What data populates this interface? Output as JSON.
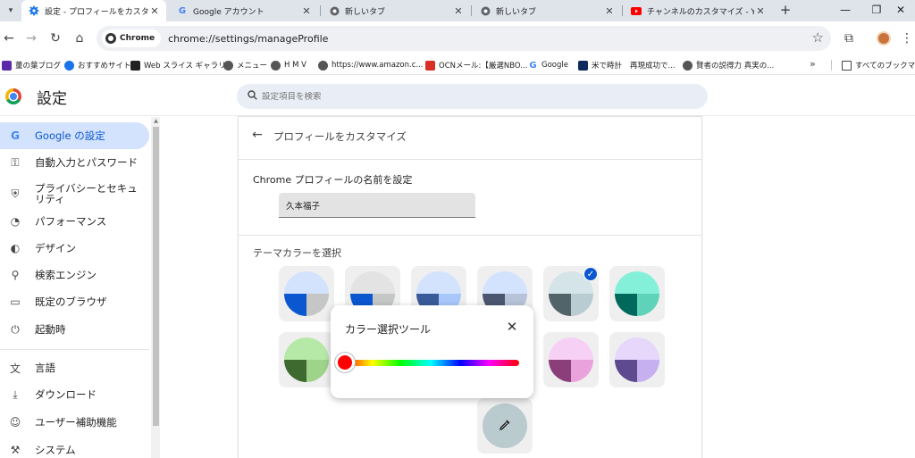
{
  "tabs": [
    {
      "label": "設定 - プロフィールをカスタマイズ",
      "active": true,
      "icon": "gear-icon"
    },
    {
      "label": "Google アカウント",
      "active": false,
      "icon": "google-icon"
    },
    {
      "label": "新しいタブ",
      "active": false,
      "icon": "chrome-icon"
    },
    {
      "label": "新しいタブ",
      "active": false,
      "icon": "chrome-icon"
    },
    {
      "label": "チャンネルのカスタマイズ - YouTube",
      "active": false,
      "icon": "youtube-icon"
    }
  ],
  "toolbar": {
    "chip_label": "Chrome",
    "url": "chrome://settings/manageProfile"
  },
  "bookmarks": [
    {
      "label": "董の葉ブログ",
      "color": "#5b2aa8"
    },
    {
      "label": "おすすめサイト",
      "color": "#1a73e8"
    },
    {
      "label": "Web スライス ギャラリー",
      "color": "#222222"
    },
    {
      "label": "メニュー",
      "color": "#444444"
    },
    {
      "label": "H M V",
      "color": "#444444"
    },
    {
      "label": "https://www.amazon.c...",
      "color": "#444444"
    },
    {
      "label": "OCNメール:【厳選NBO...",
      "color": "#d93025"
    },
    {
      "label": "Google",
      "color": "#4285f4"
    },
    {
      "label": "米で時計",
      "color": "#0d2a5c"
    },
    {
      "label": "再現成功で...",
      "color": "#ffffff"
    },
    {
      "label": "賢者の説得力 真実の...",
      "color": "#444444"
    }
  ],
  "bookmarks_all": "すべてのブックマーク",
  "bookmarks_more": "»",
  "settings": {
    "title": "設定",
    "search_placeholder": "設定項目を検索"
  },
  "sidebar": {
    "items": [
      {
        "label": "Google の設定",
        "icon": "G",
        "active": true
      },
      {
        "label": "自動入力とパスワード",
        "icon": "⚿",
        "active": false
      },
      {
        "label": "プライバシーとセキュリティ",
        "icon": "⛨",
        "active": false
      },
      {
        "label": "パフォーマンス",
        "icon": "◔",
        "active": false
      },
      {
        "label": "デザイン",
        "icon": "◐",
        "active": false
      },
      {
        "label": "検索エンジン",
        "icon": "⚲",
        "active": false
      },
      {
        "label": "既定のブラウザ",
        "icon": "▭",
        "active": false
      },
      {
        "label": "起動時",
        "icon": "⏻",
        "active": false
      },
      {
        "label": "言語",
        "icon": "文",
        "active": false
      },
      {
        "label": "ダウンロード",
        "icon": "⤓",
        "active": false
      },
      {
        "label": "ユーザー補助機能",
        "icon": "☺",
        "active": false
      },
      {
        "label": "システム",
        "icon": "⚒",
        "active": false
      }
    ]
  },
  "main": {
    "heading": "プロフィールをカスタマイズ",
    "name_label": "Chrome プロフィールの名前を設定",
    "name_value": "久本福子",
    "theme_label": "テーマカラーを選択",
    "swatches": [
      {
        "top": "#d3e3fd",
        "bl": "#0b57d0",
        "br": "#c4c7c5",
        "selected": false
      },
      {
        "top": "#e3e3e3",
        "bl": "#0b57d0",
        "br": "#c4c7c5",
        "selected": false
      },
      {
        "top": "#d3e3fd",
        "bl": "#3a5a99",
        "br": "#a8c7fa",
        "selected": false
      },
      {
        "top": "#d3e3fd",
        "bl": "#4a5670",
        "br": "#b7c3d9",
        "selected": false
      },
      {
        "top": "#d5e4e8",
        "bl": "#52636a",
        "br": "#b8ccd2",
        "selected": true
      },
      {
        "top": "#85f0d9",
        "bl": "#00695c",
        "br": "#5fd3b9",
        "selected": false
      },
      {
        "top": "#b6e8a8",
        "bl": "#3f6a2f",
        "br": "#9ed48a",
        "selected": false
      },
      {
        "top": "#ffd9c9",
        "bl": "#6a5348",
        "br": "#e6bfb0",
        "selected": false
      },
      {
        "top": "#ffd6dd",
        "bl": "#8a3d4e",
        "br": "#f4a7b6",
        "selected": false
      },
      {
        "top": "#ffd6dd",
        "bl": "#6d4c52",
        "br": "#dab8bd",
        "selected": false
      },
      {
        "top": "#f7d0f5",
        "bl": "#8a3f7a",
        "br": "#eaa2dc",
        "selected": false
      },
      {
        "top": "#e6d7fb",
        "bl": "#5e4a8f",
        "br": "#c7b0f0",
        "selected": false
      }
    ]
  },
  "popup": {
    "title": "カラー選択ツール",
    "hue_position": 0,
    "selected_color": "#ff0000"
  }
}
